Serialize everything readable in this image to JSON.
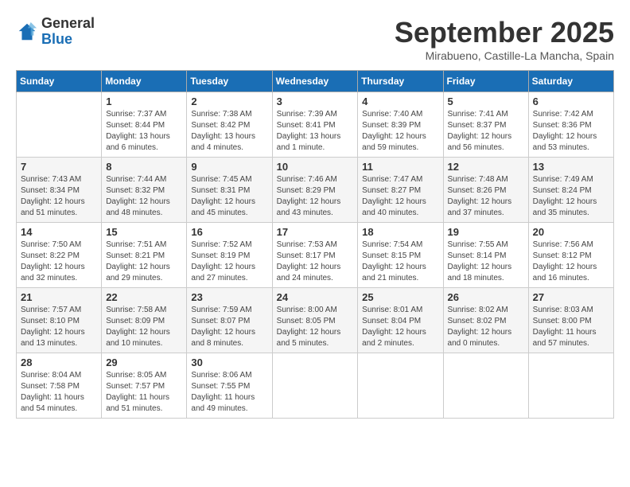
{
  "header": {
    "logo_general": "General",
    "logo_blue": "Blue",
    "month_title": "September 2025",
    "location": "Mirabueno, Castille-La Mancha, Spain"
  },
  "columns": [
    "Sunday",
    "Monday",
    "Tuesday",
    "Wednesday",
    "Thursday",
    "Friday",
    "Saturday"
  ],
  "weeks": [
    [
      {
        "day": "",
        "sunrise": "",
        "sunset": "",
        "daylight": ""
      },
      {
        "day": "1",
        "sunrise": "Sunrise: 7:37 AM",
        "sunset": "Sunset: 8:44 PM",
        "daylight": "Daylight: 13 hours and 6 minutes."
      },
      {
        "day": "2",
        "sunrise": "Sunrise: 7:38 AM",
        "sunset": "Sunset: 8:42 PM",
        "daylight": "Daylight: 13 hours and 4 minutes."
      },
      {
        "day": "3",
        "sunrise": "Sunrise: 7:39 AM",
        "sunset": "Sunset: 8:41 PM",
        "daylight": "Daylight: 13 hours and 1 minute."
      },
      {
        "day": "4",
        "sunrise": "Sunrise: 7:40 AM",
        "sunset": "Sunset: 8:39 PM",
        "daylight": "Daylight: 12 hours and 59 minutes."
      },
      {
        "day": "5",
        "sunrise": "Sunrise: 7:41 AM",
        "sunset": "Sunset: 8:37 PM",
        "daylight": "Daylight: 12 hours and 56 minutes."
      },
      {
        "day": "6",
        "sunrise": "Sunrise: 7:42 AM",
        "sunset": "Sunset: 8:36 PM",
        "daylight": "Daylight: 12 hours and 53 minutes."
      }
    ],
    [
      {
        "day": "7",
        "sunrise": "Sunrise: 7:43 AM",
        "sunset": "Sunset: 8:34 PM",
        "daylight": "Daylight: 12 hours and 51 minutes."
      },
      {
        "day": "8",
        "sunrise": "Sunrise: 7:44 AM",
        "sunset": "Sunset: 8:32 PM",
        "daylight": "Daylight: 12 hours and 48 minutes."
      },
      {
        "day": "9",
        "sunrise": "Sunrise: 7:45 AM",
        "sunset": "Sunset: 8:31 PM",
        "daylight": "Daylight: 12 hours and 45 minutes."
      },
      {
        "day": "10",
        "sunrise": "Sunrise: 7:46 AM",
        "sunset": "Sunset: 8:29 PM",
        "daylight": "Daylight: 12 hours and 43 minutes."
      },
      {
        "day": "11",
        "sunrise": "Sunrise: 7:47 AM",
        "sunset": "Sunset: 8:27 PM",
        "daylight": "Daylight: 12 hours and 40 minutes."
      },
      {
        "day": "12",
        "sunrise": "Sunrise: 7:48 AM",
        "sunset": "Sunset: 8:26 PM",
        "daylight": "Daylight: 12 hours and 37 minutes."
      },
      {
        "day": "13",
        "sunrise": "Sunrise: 7:49 AM",
        "sunset": "Sunset: 8:24 PM",
        "daylight": "Daylight: 12 hours and 35 minutes."
      }
    ],
    [
      {
        "day": "14",
        "sunrise": "Sunrise: 7:50 AM",
        "sunset": "Sunset: 8:22 PM",
        "daylight": "Daylight: 12 hours and 32 minutes."
      },
      {
        "day": "15",
        "sunrise": "Sunrise: 7:51 AM",
        "sunset": "Sunset: 8:21 PM",
        "daylight": "Daylight: 12 hours and 29 minutes."
      },
      {
        "day": "16",
        "sunrise": "Sunrise: 7:52 AM",
        "sunset": "Sunset: 8:19 PM",
        "daylight": "Daylight: 12 hours and 27 minutes."
      },
      {
        "day": "17",
        "sunrise": "Sunrise: 7:53 AM",
        "sunset": "Sunset: 8:17 PM",
        "daylight": "Daylight: 12 hours and 24 minutes."
      },
      {
        "day": "18",
        "sunrise": "Sunrise: 7:54 AM",
        "sunset": "Sunset: 8:15 PM",
        "daylight": "Daylight: 12 hours and 21 minutes."
      },
      {
        "day": "19",
        "sunrise": "Sunrise: 7:55 AM",
        "sunset": "Sunset: 8:14 PM",
        "daylight": "Daylight: 12 hours and 18 minutes."
      },
      {
        "day": "20",
        "sunrise": "Sunrise: 7:56 AM",
        "sunset": "Sunset: 8:12 PM",
        "daylight": "Daylight: 12 hours and 16 minutes."
      }
    ],
    [
      {
        "day": "21",
        "sunrise": "Sunrise: 7:57 AM",
        "sunset": "Sunset: 8:10 PM",
        "daylight": "Daylight: 12 hours and 13 minutes."
      },
      {
        "day": "22",
        "sunrise": "Sunrise: 7:58 AM",
        "sunset": "Sunset: 8:09 PM",
        "daylight": "Daylight: 12 hours and 10 minutes."
      },
      {
        "day": "23",
        "sunrise": "Sunrise: 7:59 AM",
        "sunset": "Sunset: 8:07 PM",
        "daylight": "Daylight: 12 hours and 8 minutes."
      },
      {
        "day": "24",
        "sunrise": "Sunrise: 8:00 AM",
        "sunset": "Sunset: 8:05 PM",
        "daylight": "Daylight: 12 hours and 5 minutes."
      },
      {
        "day": "25",
        "sunrise": "Sunrise: 8:01 AM",
        "sunset": "Sunset: 8:04 PM",
        "daylight": "Daylight: 12 hours and 2 minutes."
      },
      {
        "day": "26",
        "sunrise": "Sunrise: 8:02 AM",
        "sunset": "Sunset: 8:02 PM",
        "daylight": "Daylight: 12 hours and 0 minutes."
      },
      {
        "day": "27",
        "sunrise": "Sunrise: 8:03 AM",
        "sunset": "Sunset: 8:00 PM",
        "daylight": "Daylight: 11 hours and 57 minutes."
      }
    ],
    [
      {
        "day": "28",
        "sunrise": "Sunrise: 8:04 AM",
        "sunset": "Sunset: 7:58 PM",
        "daylight": "Daylight: 11 hours and 54 minutes."
      },
      {
        "day": "29",
        "sunrise": "Sunrise: 8:05 AM",
        "sunset": "Sunset: 7:57 PM",
        "daylight": "Daylight: 11 hours and 51 minutes."
      },
      {
        "day": "30",
        "sunrise": "Sunrise: 8:06 AM",
        "sunset": "Sunset: 7:55 PM",
        "daylight": "Daylight: 11 hours and 49 minutes."
      },
      {
        "day": "",
        "sunrise": "",
        "sunset": "",
        "daylight": ""
      },
      {
        "day": "",
        "sunrise": "",
        "sunset": "",
        "daylight": ""
      },
      {
        "day": "",
        "sunrise": "",
        "sunset": "",
        "daylight": ""
      },
      {
        "day": "",
        "sunrise": "",
        "sunset": "",
        "daylight": ""
      }
    ]
  ]
}
